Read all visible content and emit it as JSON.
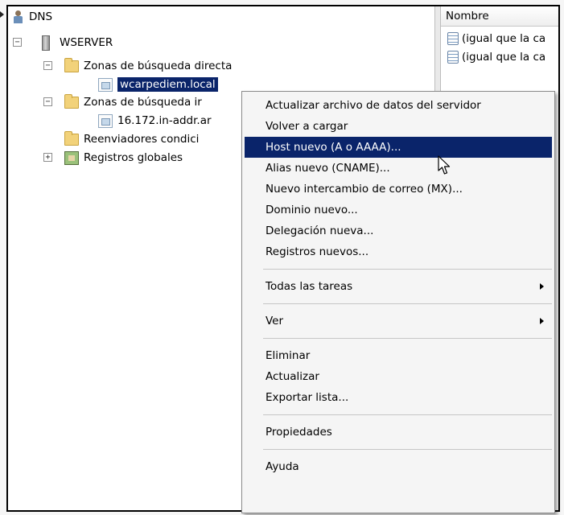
{
  "tree": {
    "root": "DNS",
    "server": "WSERVER",
    "forward_zones": "Zonas de búsqueda directa",
    "selected_zone": "wcarpediem.local",
    "reverse_zones": "Zonas de búsqueda ir",
    "reverse_zone_item": "16.172.in-addr.ar",
    "conditional_forwarders": "Reenviadores condici",
    "global_records": "Registros globales"
  },
  "list": {
    "column_header": "Nombre",
    "rows": [
      "(igual que la ca",
      "(igual que la ca"
    ]
  },
  "context_menu": {
    "items": [
      "Actualizar archivo de datos del servidor",
      "Volver a cargar",
      "Host nuevo (A o AAAA)...",
      "Alias nuevo (CNAME)...",
      "Nuevo intercambio de correo (MX)...",
      "Dominio nuevo...",
      "Delegación nueva...",
      "Registros nuevos...",
      "Todas las tareas",
      "Ver",
      "Eliminar",
      "Actualizar",
      "Exportar lista...",
      "Propiedades",
      "Ayuda"
    ],
    "highlighted_item": "Host nuevo (A o AAAA)...",
    "highlight_color": "#0a246a"
  },
  "icons": [
    "dns-icon",
    "server-icon",
    "folder-icon",
    "zone-icon",
    "global-records-icon",
    "record-icon",
    "mouse-cursor-icon"
  ]
}
